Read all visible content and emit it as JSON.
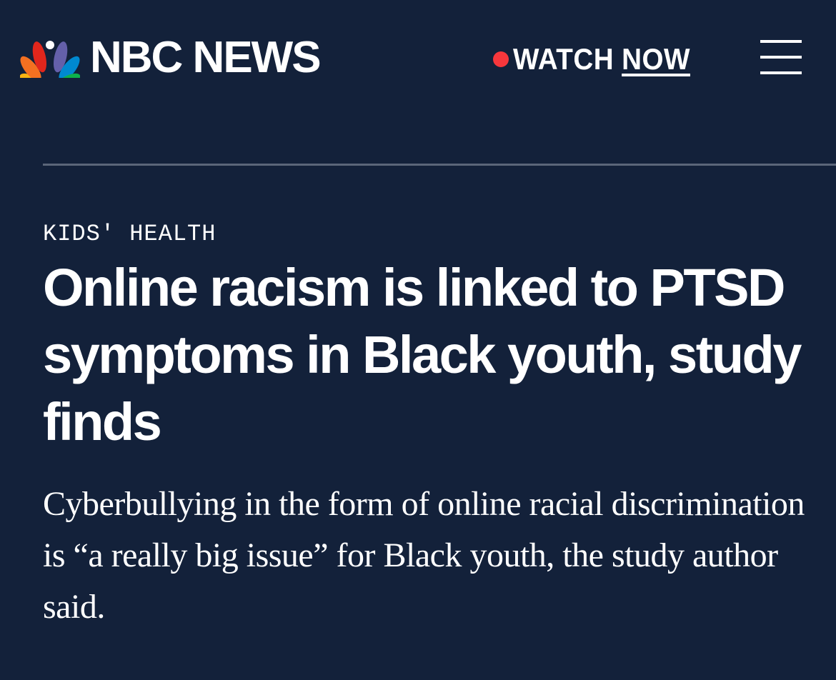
{
  "header": {
    "brand": "NBC NEWS",
    "logo_icon": "nbc-peacock-icon",
    "watch_label": "WATCH",
    "now_label": "NOW",
    "live_dot_color": "#f7373c",
    "menu_icon": "hamburger-menu-icon"
  },
  "article": {
    "category": "KIDS' HEALTH",
    "headline": "Online racism is linked to PTSD symptoms in Black youth, study finds",
    "dek": "Cyberbullying in the form of online racial discrimination is “a really big issue” for Black youth, the study author said."
  },
  "colors": {
    "background": "#13213a",
    "divider": "#5b6679",
    "text": "#ffffff"
  }
}
